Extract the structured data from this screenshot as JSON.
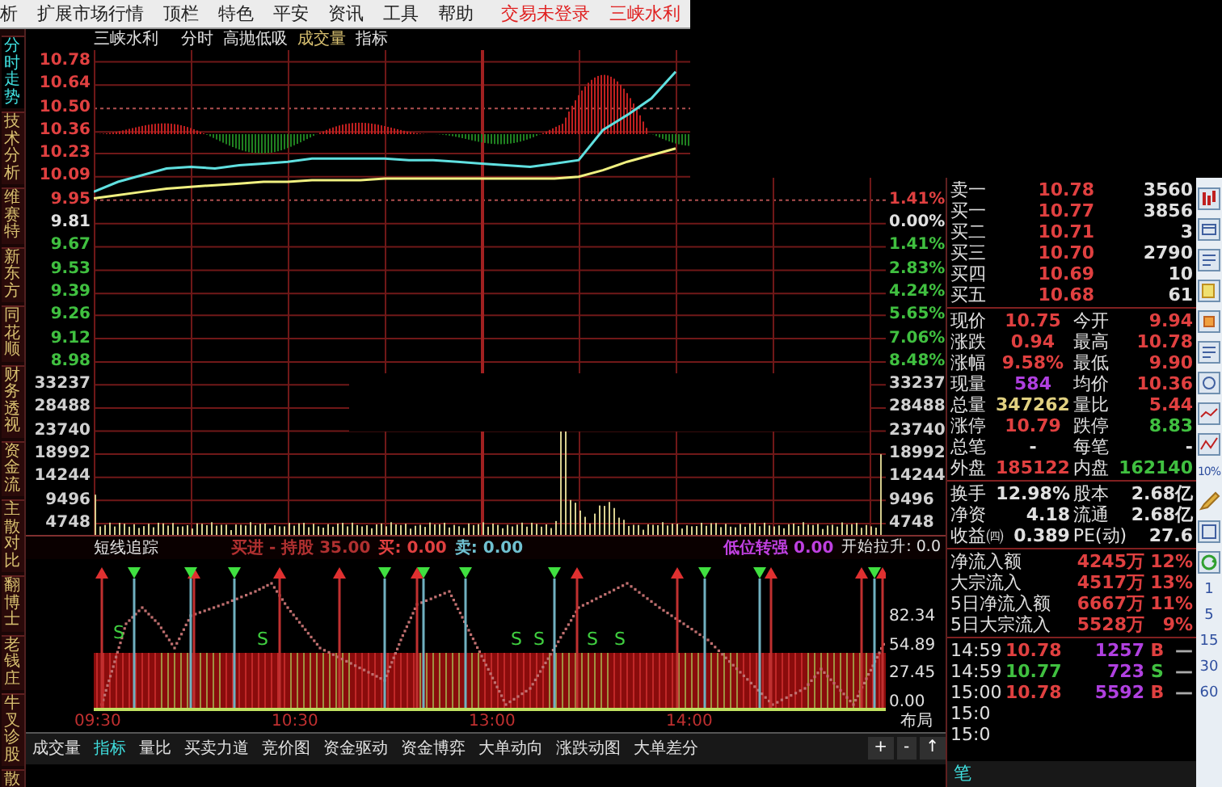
{
  "menu_bar": {
    "items": [
      "析",
      "扩展市场行情",
      "顶栏",
      "特色",
      "平安",
      "资讯",
      "工具",
      "帮助"
    ],
    "status_items": [
      "交易未登录",
      "三峡水利"
    ]
  },
  "side_tabs": [
    {
      "label": "分时走势",
      "selected": true
    },
    {
      "label": "技术分析",
      "selected": false
    },
    {
      "label": "维赛特",
      "selected": false
    },
    {
      "label": "新东方",
      "selected": false
    },
    {
      "label": "同花顺",
      "selected": false
    },
    {
      "label": "财务透视",
      "selected": false
    },
    {
      "label": "资金流",
      "selected": false
    },
    {
      "label": "主散对比",
      "selected": false
    },
    {
      "label": "翻博士",
      "selected": false
    },
    {
      "label": "老钱庄",
      "selected": false
    },
    {
      "label": "牛叉诊股",
      "selected": false
    },
    {
      "label": "散",
      "selected": false
    }
  ],
  "chart_header": [
    {
      "text": "三峡水利",
      "color": "#e0e0e0"
    },
    {
      "text": "分时",
      "color": "#e0e0e0"
    },
    {
      "text": "高抛低吸",
      "color": "#e0e0e0"
    },
    {
      "text": "成交量",
      "color": "#d8c070"
    },
    {
      "text": "指标",
      "color": "#e0e0e0"
    }
  ],
  "price_chart": {
    "left_axis": [
      {
        "color": "#e04040"
      },
      {
        "color": "#e04040"
      },
      {
        "color": "#e04040"
      },
      {
        "color": "#e04040"
      },
      {
        "color": "#e04040"
      },
      {
        "color": "#e04040"
      },
      {
        "color": "#e04040"
      },
      {
        "color": "#e0e0e0"
      },
      {
        "color": "#40c040"
      },
      {
        "color": "#40c040"
      },
      {
        "color": "#40c040"
      },
      {
        "color": "#40c040"
      },
      {
        "color": "#40c040"
      },
      {
        "color": "#40c040"
      }
    ],
    "chart_data": {
      "type": "line",
      "ylim": [
        7.94,
        10.85
      ],
      "grid": true,
      "yticks": [
        {
          "value": 10.78,
          "label": "10.78"
        },
        {
          "value": 10.64,
          "label": "10.64"
        },
        {
          "value": 10.5,
          "label": "10.50"
        },
        {
          "value": 10.36,
          "label": "10.36"
        },
        {
          "value": 10.23,
          "label": "10.23"
        },
        {
          "value": 10.09,
          "label": "10.09"
        },
        {
          "value": 9.95,
          "label": "9.95"
        },
        {
          "value": 9.81,
          "label": "9.81"
        },
        {
          "value": 9.67,
          "label": "9.67"
        },
        {
          "value": 9.53,
          "label": "9.53"
        },
        {
          "value": 9.39,
          "label": "9.39"
        },
        {
          "value": 9.26,
          "label": "9.26"
        },
        {
          "value": 9.12,
          "label": "9.12"
        },
        {
          "value": 8.98,
          "label": "8.98"
        }
      ],
      "categories": [
        null,
        null,
        null,
        null,
        null,
        null,
        null,
        null,
        null,
        null,
        null,
        null,
        null,
        null,
        null,
        null,
        null,
        null,
        null,
        null,
        null,
        null,
        null,
        null,
        null,
        null,
        null,
        null,
        null,
        null,
        null,
        null,
        null
      ],
      "series": [
        {
          "color": "#60e0e0",
          "values": [
            10.0,
            10.06,
            10.1,
            10.14,
            10.15,
            10.14,
            10.16,
            10.17,
            10.18,
            10.2,
            10.2,
            10.2,
            10.2,
            10.19,
            10.19,
            10.18,
            10.17,
            10.16,
            10.15,
            10.17,
            10.19,
            10.37,
            10.46,
            10.56,
            10.72,
            null,
            null,
            null,
            null,
            null,
            null,
            null,
            null
          ]
        },
        {
          "color": "#f0f080",
          "values": [
            9.96,
            9.98,
            10.0,
            10.02,
            10.03,
            10.04,
            10.05,
            10.06,
            10.06,
            10.07,
            10.07,
            10.07,
            10.08,
            10.08,
            10.08,
            10.08,
            10.08,
            10.08,
            10.08,
            10.08,
            10.09,
            10.13,
            10.18,
            10.22,
            10.26,
            null,
            null,
            null,
            null,
            null,
            null,
            null,
            null
          ]
        }
      ]
    },
    "right_axis": [
      {
        "text": "1.41%",
        "color": "#e04040"
      },
      {
        "text": "0.00%",
        "color": "#e0e0e0"
      },
      {
        "text": "1.41%",
        "color": "#40c040"
      },
      {
        "text": "2.83%",
        "color": "#40c040"
      },
      {
        "text": "4.24%",
        "color": "#40c040"
      },
      {
        "text": "5.65%",
        "color": "#40c040"
      },
      {
        "text": "7.06%",
        "color": "#40c040"
      },
      {
        "text": "8.48%",
        "color": "#40c040"
      }
    ]
  },
  "volume_chart": {
    "left_axis": [
      {
        "text": "33237",
        "color": "#d0d0d0"
      },
      {
        "text": "28488",
        "color": "#d0d0d0"
      },
      {
        "text": "23740",
        "color": "#d0d0d0"
      },
      {
        "text": "18992",
        "color": "#d0d0d0"
      },
      {
        "text": "14244",
        "color": "#d0d0d0"
      },
      {
        "text": "9496",
        "color": "#d0d0d0"
      },
      {
        "text": "4748",
        "color": "#d0d0d0"
      }
    ],
    "right_axis": [
      {
        "text": "33237",
        "color": "#d0d0d0"
      },
      {
        "text": "28488",
        "color": "#d0d0d0"
      },
      {
        "text": "23740",
        "color": "#d0d0d0"
      },
      {
        "text": "18992",
        "color": "#d0d0d0"
      },
      {
        "text": "14244",
        "color": "#d0d0d0"
      },
      {
        "text": "9496",
        "color": "#d0d0d0"
      },
      {
        "text": "4748",
        "color": "#d0d0d0"
      }
    ]
  },
  "indicator": {
    "title": "短线追踪",
    "readouts": [
      {
        "text": "买进 - 持股 35.00",
        "color": "#b03030"
      },
      {
        "text": "买: 0.00",
        "color": "#e04040"
      },
      {
        "text": "卖: 0.00",
        "color": "#70c0d0"
      },
      {
        "text": "低位转强 0.00",
        "color": "#c040e0"
      },
      {
        "text": "开始拉升: 0.0",
        "color": "#e0e0e0"
      }
    ],
    "axis": [
      "82.34",
      "54.89",
      "27.45",
      "0.00"
    ],
    "signals": [
      "S",
      "S",
      "S",
      "S",
      "S",
      "S"
    ]
  },
  "time_axis": [
    "09:30",
    "10:30",
    "13:00",
    "14:00"
  ],
  "layout_label": "布局",
  "bottom_tabs": [
    {
      "label": "成交量",
      "selected": false
    },
    {
      "label": "指标",
      "selected": true
    },
    {
      "label": "量比",
      "selected": false
    },
    {
      "label": "买卖力道",
      "selected": false
    },
    {
      "label": "竞价图",
      "selected": false
    },
    {
      "label": "资金驱动",
      "selected": false
    },
    {
      "label": "资金博弈",
      "selected": false
    },
    {
      "label": "大单动向",
      "selected": false
    },
    {
      "label": "涨跌动图",
      "selected": false
    },
    {
      "label": "大单差分",
      "selected": false
    }
  ],
  "zoom_buttons": [
    "+",
    "-",
    "↑"
  ],
  "quote_panel": {
    "order_book": [
      {
        "label": "卖一",
        "price": "10.78",
        "volume": "3560"
      },
      {
        "label": "买一",
        "price": "10.77",
        "volume": "3856"
      },
      {
        "label": "买二",
        "price": "10.71",
        "volume": "3"
      },
      {
        "label": "买三",
        "price": "10.70",
        "volume": "2790"
      },
      {
        "label": "买四",
        "price": "10.69",
        "volume": "10"
      },
      {
        "label": "买五",
        "price": "10.68",
        "volume": "61"
      }
    ],
    "stats": [
      {
        "label": "现价",
        "value": "10.75",
        "color": "#e04040"
      },
      {
        "label": "今开",
        "value": "9.94",
        "color": "#e04040"
      },
      {
        "label": "涨跌",
        "value": "0.94",
        "color": "#e04040"
      },
      {
        "label": "最高",
        "value": "10.78",
        "color": "#e04040"
      },
      {
        "label": "涨幅",
        "value": "9.58%",
        "color": "#e04040"
      },
      {
        "label": "最低",
        "value": "9.90",
        "color": "#e04040"
      },
      {
        "label": "现量",
        "value": "584",
        "color": "#b040e0"
      },
      {
        "label": "均价",
        "value": "10.36",
        "color": "#e04040"
      },
      {
        "label": "总量",
        "value": "347262",
        "color": "#e0d080"
      },
      {
        "label": "量比",
        "value": "5.44",
        "color": "#e04040"
      },
      {
        "label": "涨停",
        "value": "10.79",
        "color": "#e04040"
      },
      {
        "label": "跌停",
        "value": "8.83",
        "color": "#40c040"
      },
      {
        "label": "总笔",
        "value": "-",
        "color": "#e0e0e0"
      },
      {
        "label": "每笔",
        "value": "-",
        "color": "#e0e0e0"
      },
      {
        "label": "外盘",
        "value": "185122",
        "color": "#e04040"
      },
      {
        "label": "内盘",
        "value": "162140",
        "color": "#40c040"
      }
    ],
    "fundamentals": [
      {
        "label": "换手",
        "value": "12.98%"
      },
      {
        "label": "股本",
        "value": "2.68亿"
      },
      {
        "label": "净资",
        "value": "4.18"
      },
      {
        "label": "流通",
        "value": "2.68亿"
      },
      {
        "label": "收益㈣",
        "value": "0.389"
      },
      {
        "label": "PE(动)",
        "value": "27.6"
      }
    ],
    "flows": [
      {
        "label": "净流入额",
        "value": "4245万",
        "share": "12%"
      },
      {
        "label": "大宗流入",
        "value": "4517万",
        "share": "13%"
      },
      {
        "label": "5日净流入额",
        "value": "6667万",
        "share": "11%"
      },
      {
        "label": "5日大宗流入",
        "value": "5528万",
        "share": "9%"
      }
    ],
    "ticks": [
      {
        "time": "14:59",
        "price": "10.78",
        "volume": "1257",
        "side": "B",
        "color": "#e04040",
        "mark": "—"
      },
      {
        "time": "14:59",
        "price": "10.77",
        "volume": "723",
        "side": "S",
        "color": "#40c040",
        "mark": "—"
      },
      {
        "time": "15:00",
        "price": "10.78",
        "volume": "5592",
        "side": "B",
        "color": "#e04040",
        "mark": "—"
      },
      {
        "time": "15:0"
      },
      {
        "time": "15:0"
      }
    ],
    "detail_tab": "笔"
  },
  "tool_strip": {
    "percent_label": "10%",
    "periods": [
      "1",
      "5",
      "15",
      "30",
      "60"
    ]
  }
}
